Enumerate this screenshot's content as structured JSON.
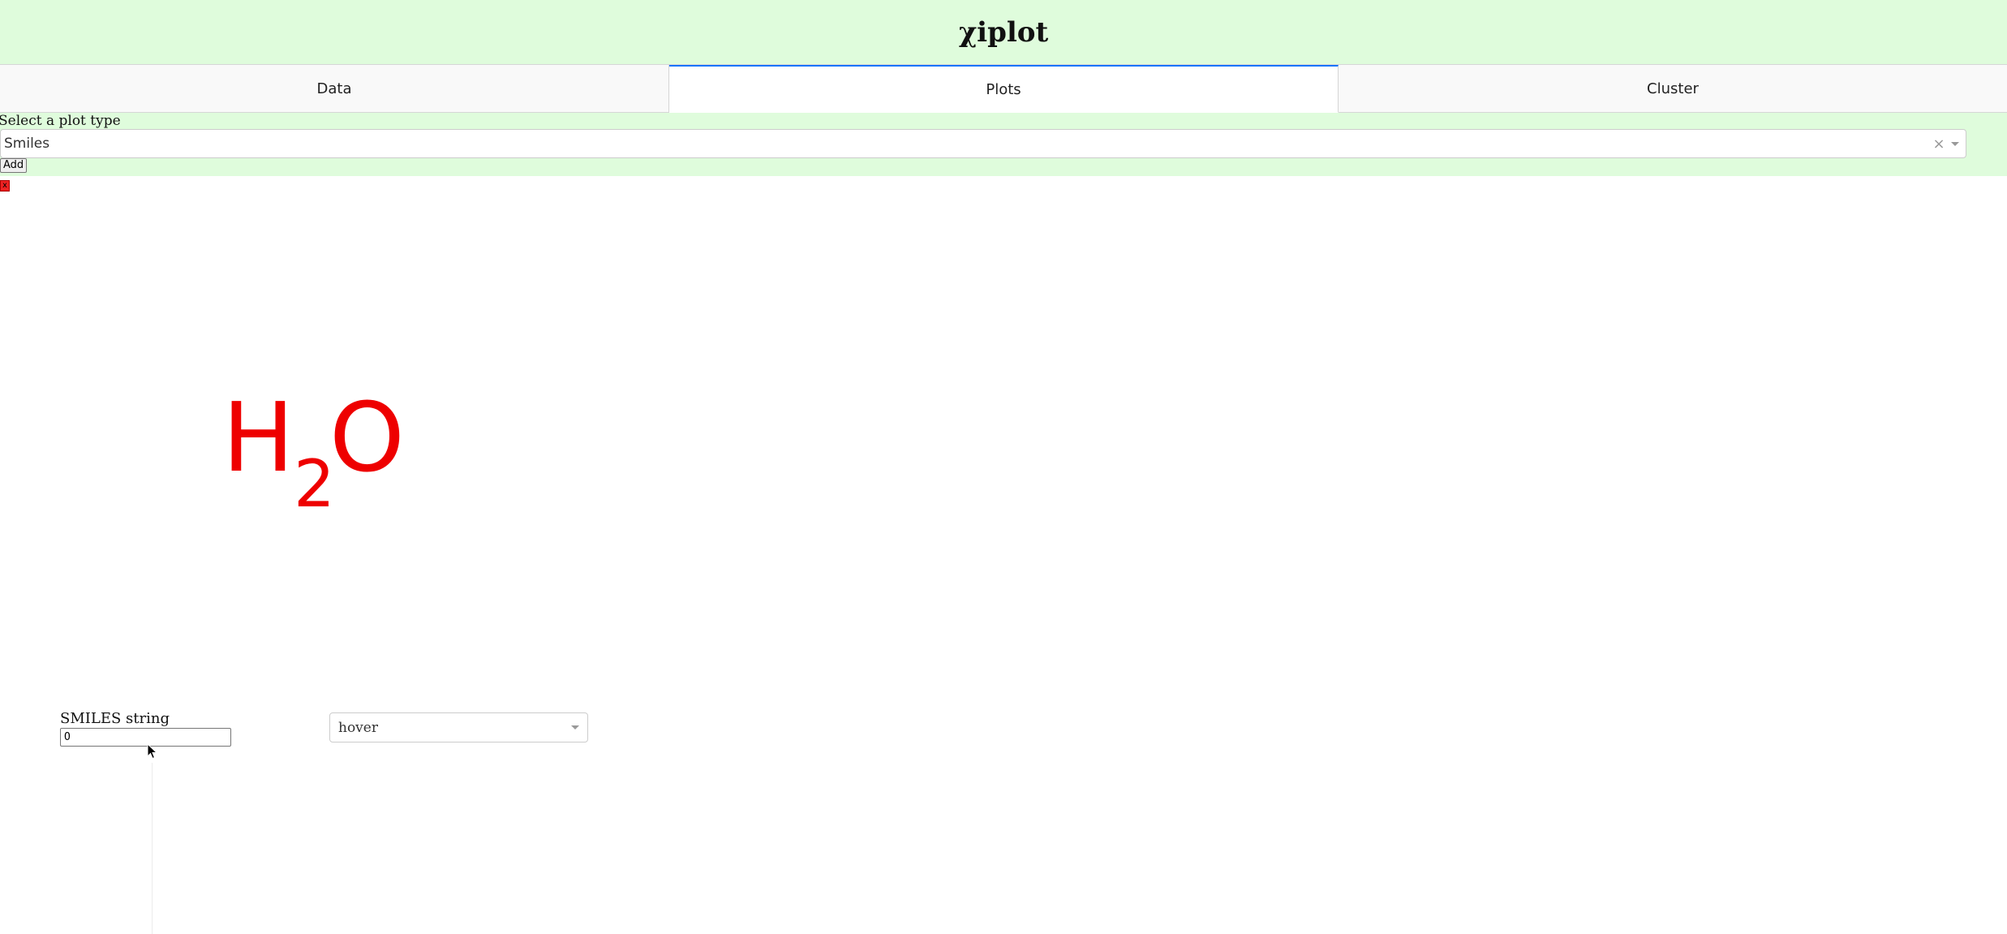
{
  "header": {
    "title": "χiplot"
  },
  "tabs": [
    {
      "label": "Data",
      "active": false
    },
    {
      "label": "Plots",
      "active": true
    },
    {
      "label": "Cluster",
      "active": false
    }
  ],
  "plot_type": {
    "label": "Select a plot type",
    "selected": "Smiles",
    "clear_glyph": "×"
  },
  "add_button": {
    "label": "Add"
  },
  "remove_button": {
    "label": "x"
  },
  "molecule": {
    "formula_main": "H",
    "formula_subscript": "2",
    "formula_tail": "O",
    "color": "#ee0000"
  },
  "smiles": {
    "label": "SMILES string",
    "value": "O"
  },
  "mode_select": {
    "selected": "hover"
  },
  "colors": {
    "accent": "#1975fa",
    "panel_bg": "#dffcdc"
  },
  "icons": {
    "cursor": "pointer-arrow-icon",
    "dropdown": "chevron-down-icon",
    "clear": "clear-x-icon"
  }
}
